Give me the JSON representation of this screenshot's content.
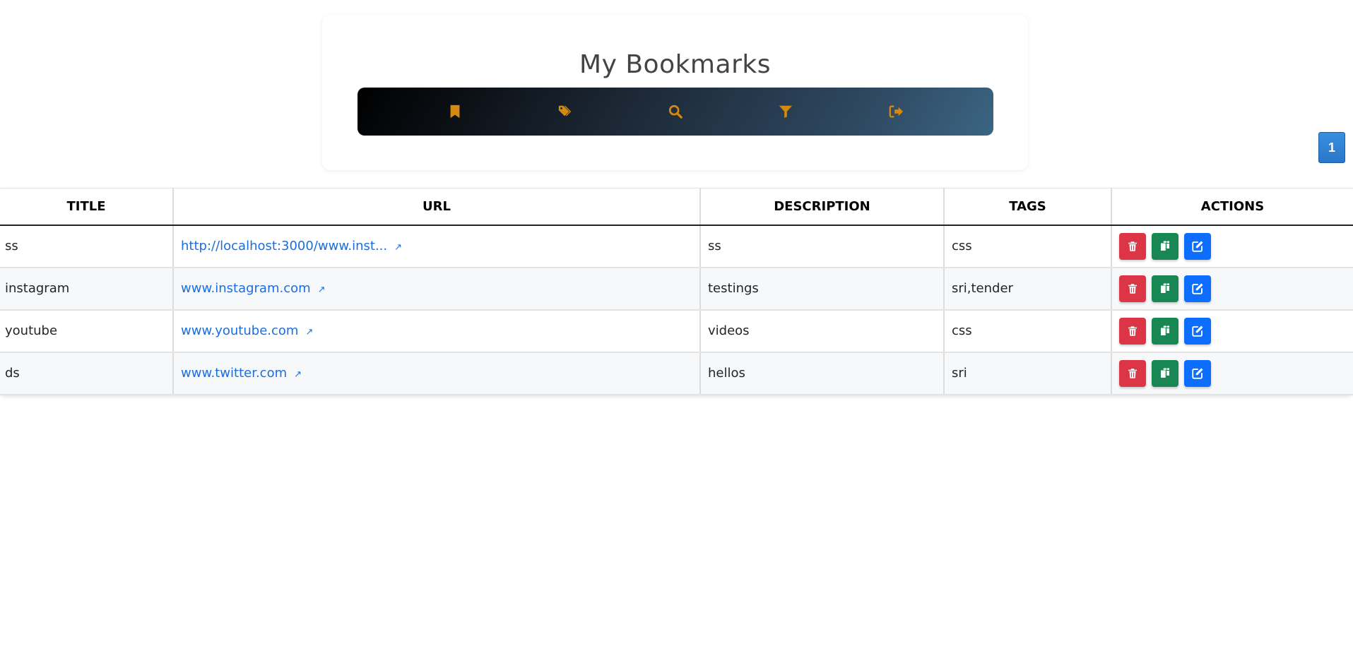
{
  "header": {
    "title": "My Bookmarks"
  },
  "navbar": {
    "icon_color": "#d68910",
    "items": [
      {
        "icon": "bookmark-icon"
      },
      {
        "icon": "tags-icon"
      },
      {
        "icon": "search-icon"
      },
      {
        "icon": "filter-icon"
      },
      {
        "icon": "logout-icon"
      }
    ]
  },
  "pagination": {
    "current_page": "1"
  },
  "table": {
    "columns": [
      "TITLE",
      "URL",
      "DESCRIPTION",
      "TAGS",
      "ACTIONS"
    ],
    "rows": [
      {
        "title": "ss",
        "url": "http://localhost:3000/www.inst...",
        "description": "ss",
        "tags": "css"
      },
      {
        "title": "instagram",
        "url": "www.instagram.com",
        "description": "testings",
        "tags": "sri,tender"
      },
      {
        "title": "youtube",
        "url": "www.youtube.com",
        "description": "videos",
        "tags": "css"
      },
      {
        "title": "ds",
        "url": "www.twitter.com",
        "description": "hellos",
        "tags": "sri"
      }
    ],
    "actions": [
      {
        "icon": "trash-icon",
        "color": "#dc3545"
      },
      {
        "icon": "copy-icon",
        "color": "#198754"
      },
      {
        "icon": "edit-icon",
        "color": "#0d6efd"
      }
    ],
    "link_color": "#1a6ee0"
  }
}
